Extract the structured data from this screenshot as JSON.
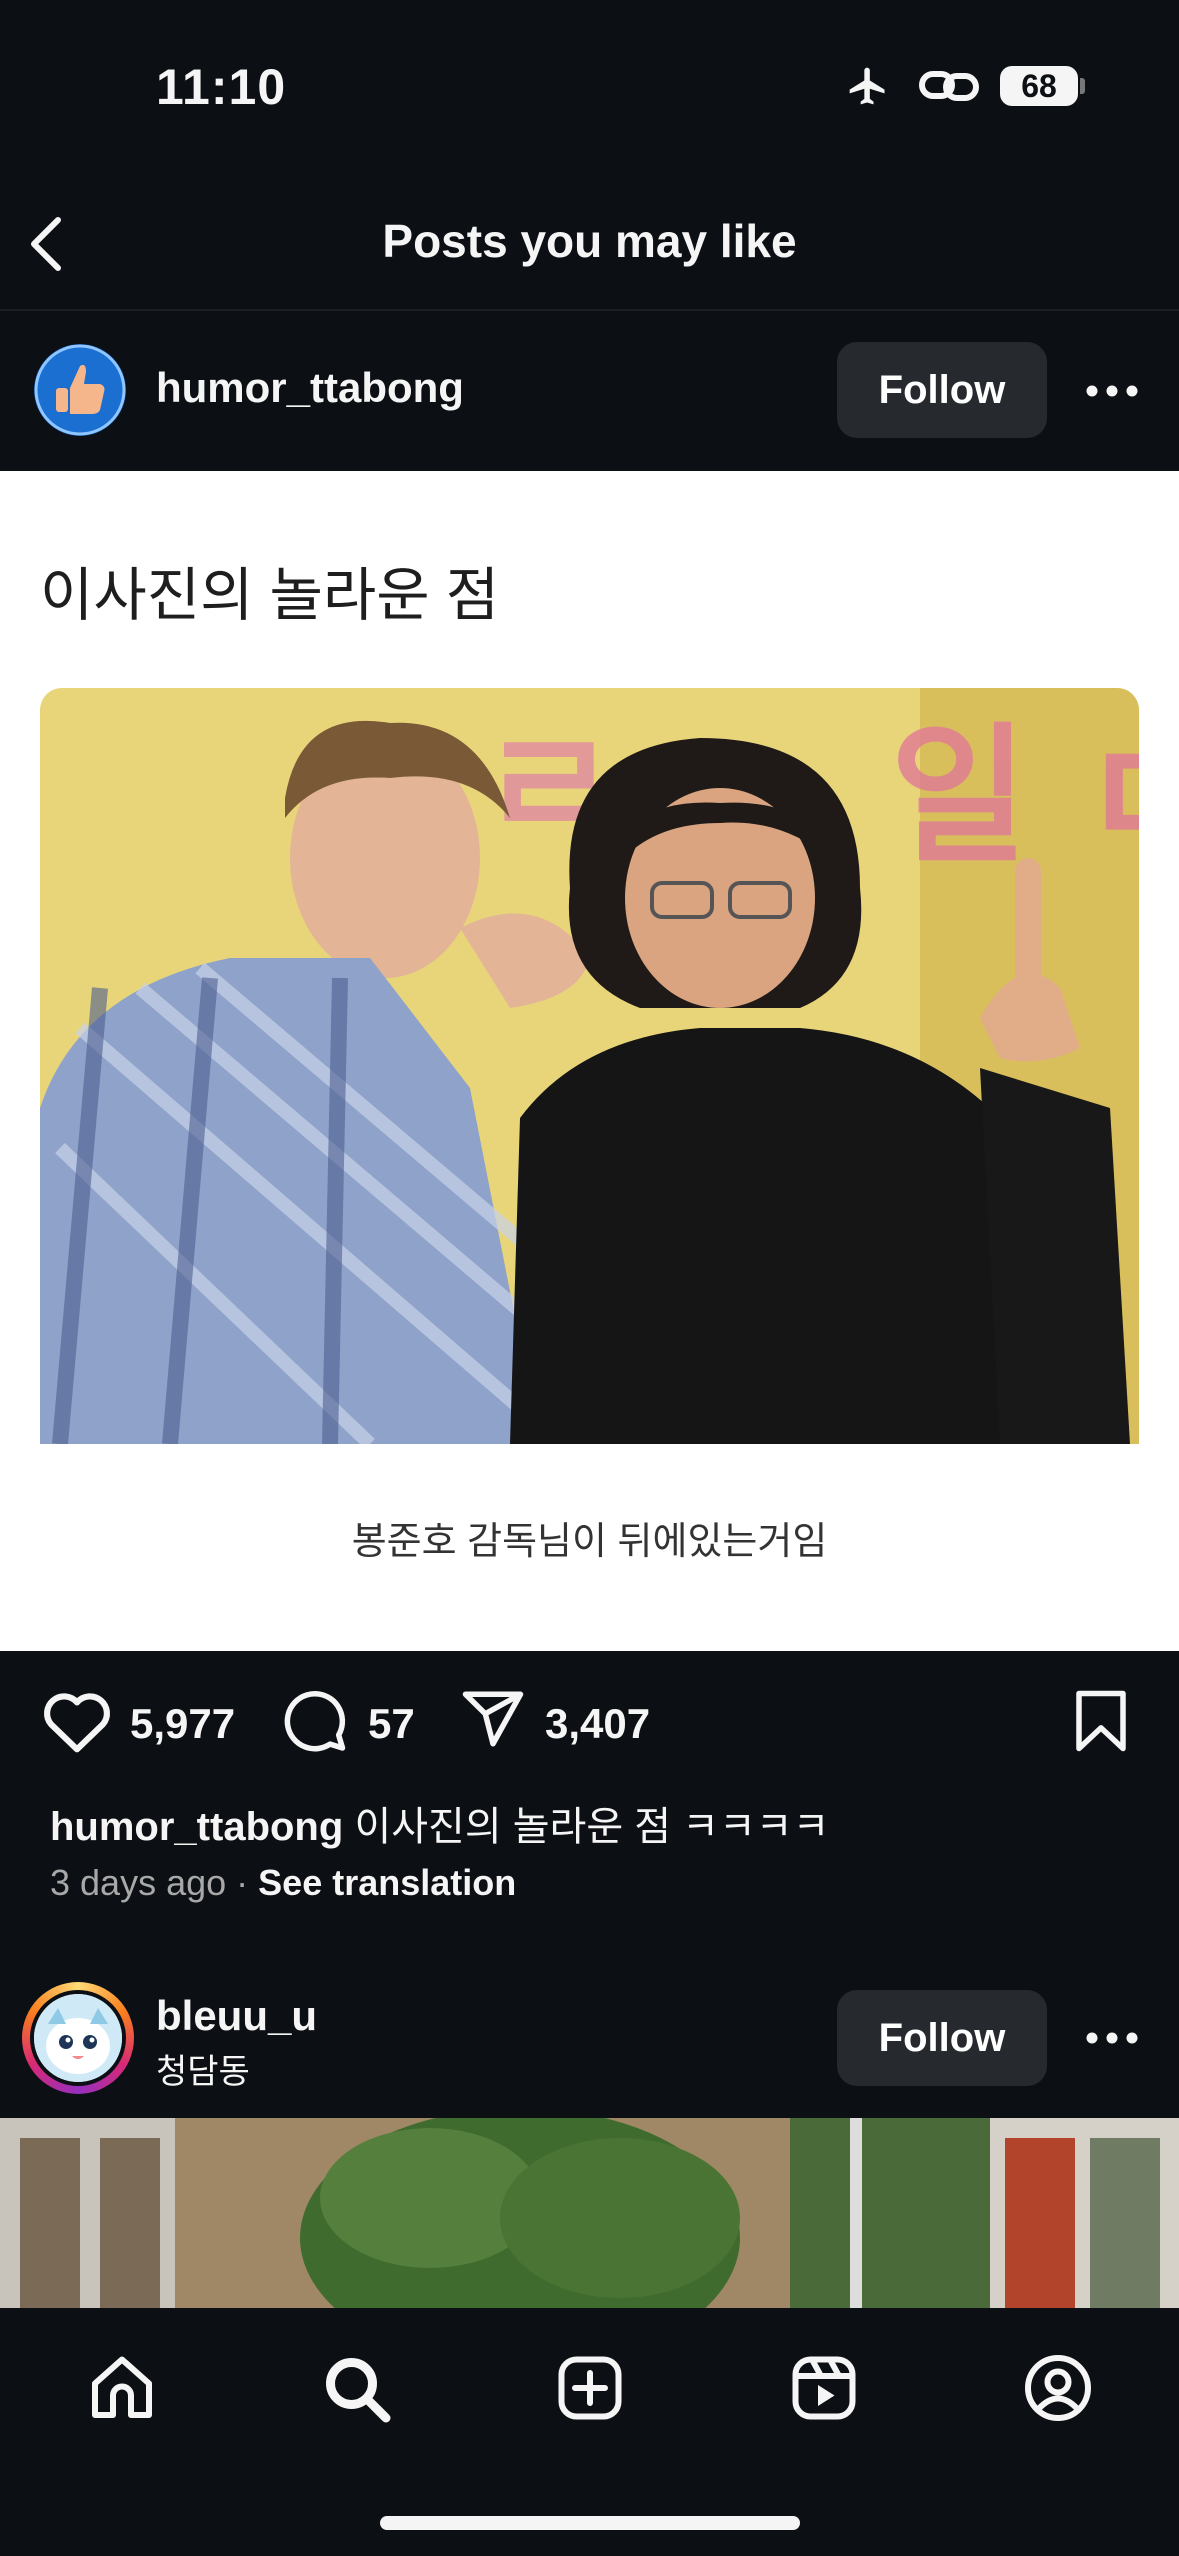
{
  "status_bar": {
    "time": "11:10",
    "battery": "68"
  },
  "header": {
    "title": "Posts you may like"
  },
  "post1": {
    "username": "humor_ttabong",
    "follow_label": "Follow",
    "image_title": "이사진의 놀라운 점",
    "image_caption": "봉준호 감독님이 뒤에있는거임",
    "likes": "5,977",
    "comments": "57",
    "shares": "3,407",
    "caption_user": "humor_ttabong",
    "caption_text": "이사진의 놀라운 점 ㅋㅋㅋㅋ",
    "time_ago": "3 days ago",
    "separator": "·",
    "see_translation": "See translation"
  },
  "post2": {
    "username": "bleuu_u",
    "location": "청담동",
    "follow_label": "Follow"
  },
  "tabs": [
    "home-icon",
    "search-icon",
    "create-icon",
    "reels-icon",
    "profile-icon"
  ],
  "colors": {
    "background": "#0c1014",
    "button": "#262a2f",
    "text": "#f5f5f5",
    "muted": "#a8a8a8"
  }
}
